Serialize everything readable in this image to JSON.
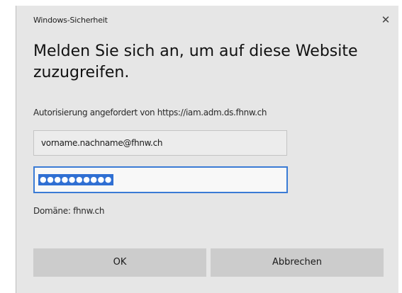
{
  "window": {
    "title": "Windows-Sicherheit",
    "close_symbol": "✕"
  },
  "heading": "Melden Sie sich an, um auf diese Website zuzugreifen.",
  "auth_info": "Autorisierung angefordert von https://iam.adm.ds.fhnw.ch",
  "username": {
    "value": "vorname.nachname@fhnw.ch"
  },
  "password": {
    "masked_value": "●●●●●●●●●●"
  },
  "domain_label": "Domäne: fhnw.ch",
  "buttons": {
    "ok": "OK",
    "cancel": "Abbrechen"
  },
  "colors": {
    "dialog_background": "#e6e6e6",
    "focus_border": "#3a7bd5",
    "selection": "#2f6fd3",
    "button_background": "#cccccc"
  },
  "icons": {
    "close": "close-icon"
  }
}
